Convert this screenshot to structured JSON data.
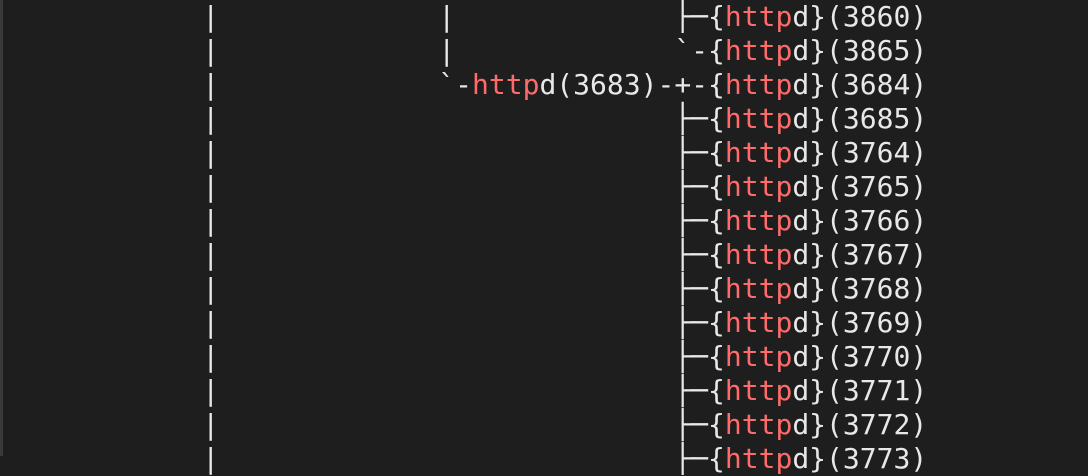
{
  "terminal": {
    "colors": {
      "background": "#1e1e1e",
      "text": "#e8e8e8",
      "match": "#ff6b6b"
    },
    "search_term": "http",
    "lines": [
      [
        {
          "t": "            |                       ├─{"
        },
        {
          "t": "http",
          "hl": true
        },
        {
          "t": "d}(3860)"
        }
      ],
      [
        {
          "t": "            |                       `-{"
        },
        {
          "t": "http",
          "hl": true
        },
        {
          "t": "d}(3865)"
        }
      ],
      [
        {
          "t": "            |             `-"
        },
        {
          "t": "http",
          "hl": true
        },
        {
          "t": "d(3683)-+-{"
        },
        {
          "t": "http",
          "hl": true
        },
        {
          "t": "d}(3684)"
        }
      ],
      [
        {
          "t": "            |                           ├─{"
        },
        {
          "t": "http",
          "hl": true
        },
        {
          "t": "d}(3685)"
        }
      ],
      [
        {
          "t": "            |                           ├─{"
        },
        {
          "t": "http",
          "hl": true
        },
        {
          "t": "d}(3764)"
        }
      ],
      [
        {
          "t": "            |                           ├─{"
        },
        {
          "t": "http",
          "hl": true
        },
        {
          "t": "d}(3765)"
        }
      ],
      [
        {
          "t": "            |                           ├─{"
        },
        {
          "t": "http",
          "hl": true
        },
        {
          "t": "d}(3766)"
        }
      ],
      [
        {
          "t": "            |                           ├─{"
        },
        {
          "t": "http",
          "hl": true
        },
        {
          "t": "d}(3767)"
        }
      ],
      [
        {
          "t": "            |                           ├─{"
        },
        {
          "t": "http",
          "hl": true
        },
        {
          "t": "d}(3768)"
        }
      ],
      [
        {
          "t": "            |                           ├─{"
        },
        {
          "t": "http",
          "hl": true
        },
        {
          "t": "d}(3769)"
        }
      ],
      [
        {
          "t": "            |                           ├─{"
        },
        {
          "t": "http",
          "hl": true
        },
        {
          "t": "d}(3770)"
        }
      ],
      [
        {
          "t": "            |                           ├─{"
        },
        {
          "t": "http",
          "hl": true
        },
        {
          "t": "d}(3771)"
        }
      ],
      [
        {
          "t": "            |                           ├─{"
        },
        {
          "t": "http",
          "hl": true
        },
        {
          "t": "d}(3772)"
        }
      ],
      [
        {
          "t": "            |                           ├─{"
        },
        {
          "t": "http",
          "hl": true
        },
        {
          "t": "d}(3773)"
        }
      ]
    ]
  }
}
